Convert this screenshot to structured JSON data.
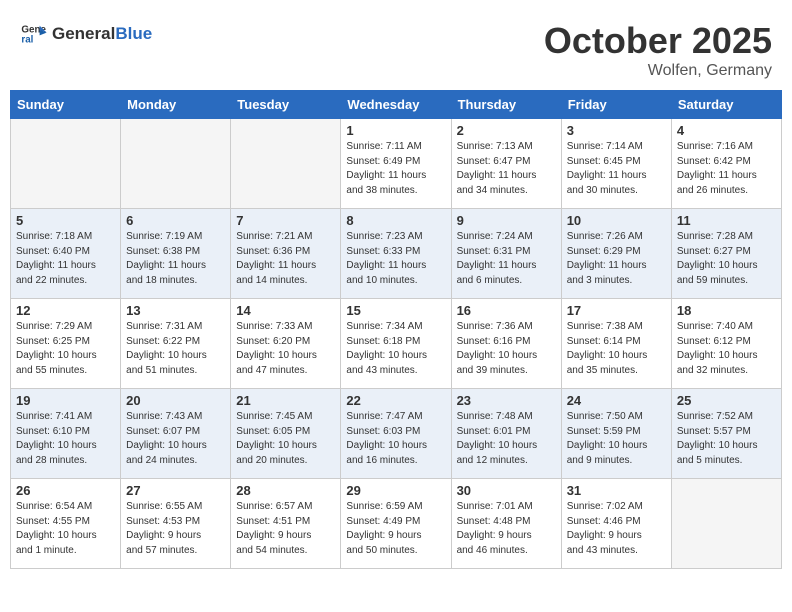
{
  "header": {
    "logo_line1": "General",
    "logo_line2": "Blue",
    "month": "October 2025",
    "location": "Wolfen, Germany"
  },
  "weekdays": [
    "Sunday",
    "Monday",
    "Tuesday",
    "Wednesday",
    "Thursday",
    "Friday",
    "Saturday"
  ],
  "weeks": [
    [
      {
        "day": "",
        "info": ""
      },
      {
        "day": "",
        "info": ""
      },
      {
        "day": "",
        "info": ""
      },
      {
        "day": "1",
        "info": "Sunrise: 7:11 AM\nSunset: 6:49 PM\nDaylight: 11 hours\nand 38 minutes."
      },
      {
        "day": "2",
        "info": "Sunrise: 7:13 AM\nSunset: 6:47 PM\nDaylight: 11 hours\nand 34 minutes."
      },
      {
        "day": "3",
        "info": "Sunrise: 7:14 AM\nSunset: 6:45 PM\nDaylight: 11 hours\nand 30 minutes."
      },
      {
        "day": "4",
        "info": "Sunrise: 7:16 AM\nSunset: 6:42 PM\nDaylight: 11 hours\nand 26 minutes."
      }
    ],
    [
      {
        "day": "5",
        "info": "Sunrise: 7:18 AM\nSunset: 6:40 PM\nDaylight: 11 hours\nand 22 minutes."
      },
      {
        "day": "6",
        "info": "Sunrise: 7:19 AM\nSunset: 6:38 PM\nDaylight: 11 hours\nand 18 minutes."
      },
      {
        "day": "7",
        "info": "Sunrise: 7:21 AM\nSunset: 6:36 PM\nDaylight: 11 hours\nand 14 minutes."
      },
      {
        "day": "8",
        "info": "Sunrise: 7:23 AM\nSunset: 6:33 PM\nDaylight: 11 hours\nand 10 minutes."
      },
      {
        "day": "9",
        "info": "Sunrise: 7:24 AM\nSunset: 6:31 PM\nDaylight: 11 hours\nand 6 minutes."
      },
      {
        "day": "10",
        "info": "Sunrise: 7:26 AM\nSunset: 6:29 PM\nDaylight: 11 hours\nand 3 minutes."
      },
      {
        "day": "11",
        "info": "Sunrise: 7:28 AM\nSunset: 6:27 PM\nDaylight: 10 hours\nand 59 minutes."
      }
    ],
    [
      {
        "day": "12",
        "info": "Sunrise: 7:29 AM\nSunset: 6:25 PM\nDaylight: 10 hours\nand 55 minutes."
      },
      {
        "day": "13",
        "info": "Sunrise: 7:31 AM\nSunset: 6:22 PM\nDaylight: 10 hours\nand 51 minutes."
      },
      {
        "day": "14",
        "info": "Sunrise: 7:33 AM\nSunset: 6:20 PM\nDaylight: 10 hours\nand 47 minutes."
      },
      {
        "day": "15",
        "info": "Sunrise: 7:34 AM\nSunset: 6:18 PM\nDaylight: 10 hours\nand 43 minutes."
      },
      {
        "day": "16",
        "info": "Sunrise: 7:36 AM\nSunset: 6:16 PM\nDaylight: 10 hours\nand 39 minutes."
      },
      {
        "day": "17",
        "info": "Sunrise: 7:38 AM\nSunset: 6:14 PM\nDaylight: 10 hours\nand 35 minutes."
      },
      {
        "day": "18",
        "info": "Sunrise: 7:40 AM\nSunset: 6:12 PM\nDaylight: 10 hours\nand 32 minutes."
      }
    ],
    [
      {
        "day": "19",
        "info": "Sunrise: 7:41 AM\nSunset: 6:10 PM\nDaylight: 10 hours\nand 28 minutes."
      },
      {
        "day": "20",
        "info": "Sunrise: 7:43 AM\nSunset: 6:07 PM\nDaylight: 10 hours\nand 24 minutes."
      },
      {
        "day": "21",
        "info": "Sunrise: 7:45 AM\nSunset: 6:05 PM\nDaylight: 10 hours\nand 20 minutes."
      },
      {
        "day": "22",
        "info": "Sunrise: 7:47 AM\nSunset: 6:03 PM\nDaylight: 10 hours\nand 16 minutes."
      },
      {
        "day": "23",
        "info": "Sunrise: 7:48 AM\nSunset: 6:01 PM\nDaylight: 10 hours\nand 12 minutes."
      },
      {
        "day": "24",
        "info": "Sunrise: 7:50 AM\nSunset: 5:59 PM\nDaylight: 10 hours\nand 9 minutes."
      },
      {
        "day": "25",
        "info": "Sunrise: 7:52 AM\nSunset: 5:57 PM\nDaylight: 10 hours\nand 5 minutes."
      }
    ],
    [
      {
        "day": "26",
        "info": "Sunrise: 6:54 AM\nSunset: 4:55 PM\nDaylight: 10 hours\nand 1 minute."
      },
      {
        "day": "27",
        "info": "Sunrise: 6:55 AM\nSunset: 4:53 PM\nDaylight: 9 hours\nand 57 minutes."
      },
      {
        "day": "28",
        "info": "Sunrise: 6:57 AM\nSunset: 4:51 PM\nDaylight: 9 hours\nand 54 minutes."
      },
      {
        "day": "29",
        "info": "Sunrise: 6:59 AM\nSunset: 4:49 PM\nDaylight: 9 hours\nand 50 minutes."
      },
      {
        "day": "30",
        "info": "Sunrise: 7:01 AM\nSunset: 4:48 PM\nDaylight: 9 hours\nand 46 minutes."
      },
      {
        "day": "31",
        "info": "Sunrise: 7:02 AM\nSunset: 4:46 PM\nDaylight: 9 hours\nand 43 minutes."
      },
      {
        "day": "",
        "info": ""
      }
    ]
  ]
}
